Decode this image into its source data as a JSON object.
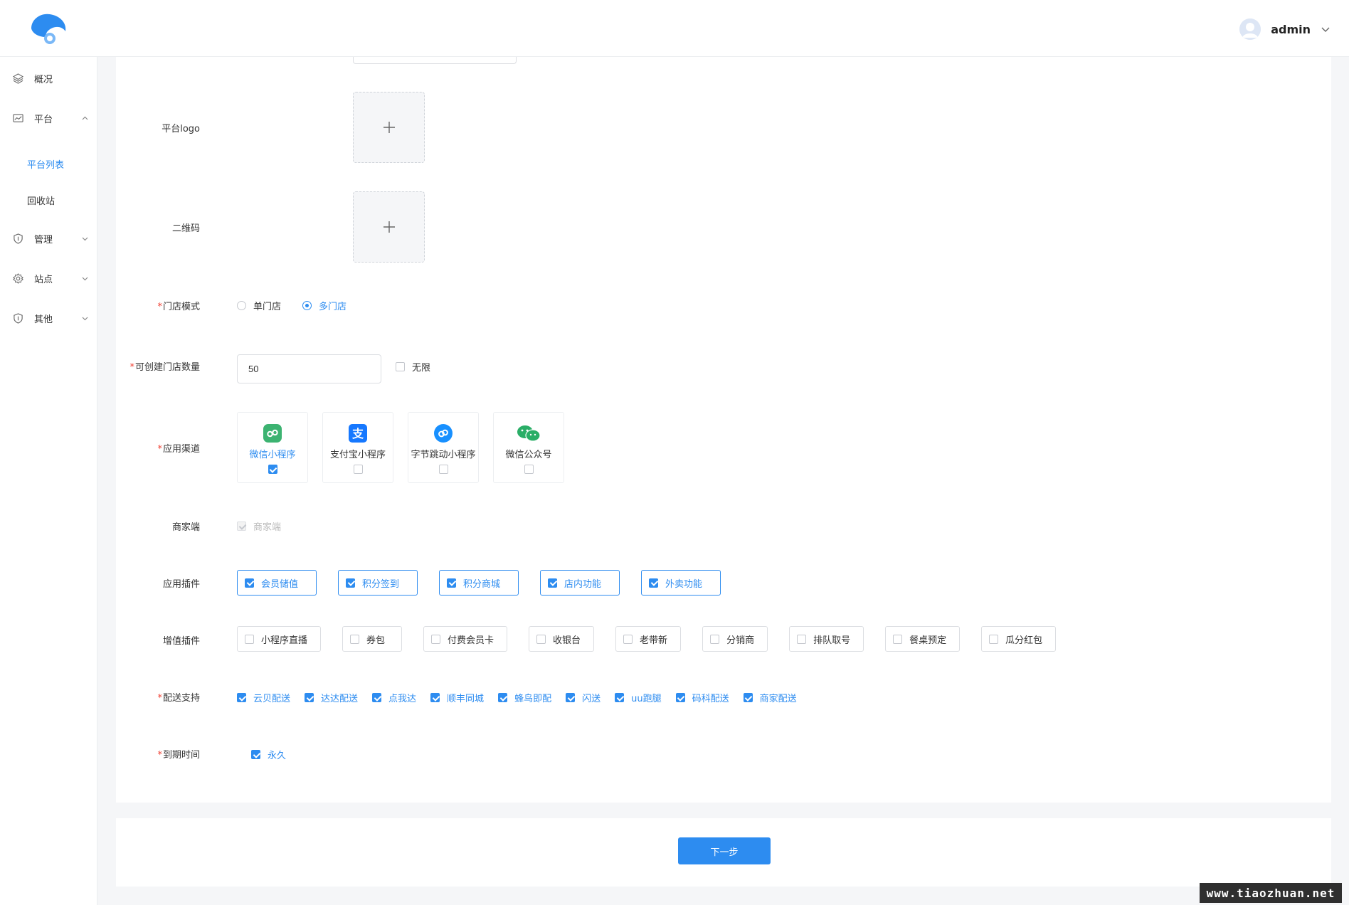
{
  "header": {
    "username": "admin"
  },
  "sidebar": {
    "items": [
      {
        "label": "概况",
        "icon": "layers-icon"
      },
      {
        "label": "平台",
        "icon": "chart-icon",
        "expanded": true
      },
      {
        "label": "管理",
        "icon": "shield-icon"
      },
      {
        "label": "站点",
        "icon": "gear-icon"
      },
      {
        "label": "其他",
        "icon": "shield-icon"
      }
    ],
    "sub_items": [
      {
        "label": "平台列表",
        "active": true
      },
      {
        "label": "回收站",
        "active": false
      }
    ]
  },
  "form": {
    "logo_label": "平台logo",
    "qrcode_label": "二维码",
    "store_mode": {
      "label": "门店模式",
      "options": [
        {
          "label": "单门店",
          "checked": false
        },
        {
          "label": "多门店",
          "checked": true
        }
      ]
    },
    "store_count": {
      "label": "可创建门店数量",
      "value": "50",
      "unlimited_label": "无限",
      "unlimited_checked": false
    },
    "channels": {
      "label": "应用渠道",
      "items": [
        {
          "label": "微信小程序",
          "checked": true,
          "color": "#3cb371"
        },
        {
          "label": "支付宝小程序",
          "checked": false,
          "color": "#1678ff"
        },
        {
          "label": "字节跳动小程序",
          "checked": false,
          "color": "#1890ff"
        },
        {
          "label": "微信公众号",
          "checked": false,
          "color": "#2aae67"
        }
      ]
    },
    "merchant": {
      "label": "商家端",
      "option": "商家端"
    },
    "plugins": {
      "label": "应用插件",
      "items": [
        "会员储值",
        "积分签到",
        "积分商城",
        "店内功能",
        "外卖功能"
      ]
    },
    "value_plugins": {
      "label": "增值插件",
      "items": [
        "小程序直播",
        "券包",
        "付费会员卡",
        "收银台",
        "老带新",
        "分销商",
        "排队取号",
        "餐桌预定",
        "瓜分红包"
      ]
    },
    "delivery": {
      "label": "配送支持",
      "items": [
        "云贝配送",
        "达达配送",
        "点我达",
        "顺丰同城",
        "蜂鸟即配",
        "闪送",
        "uu跑腿",
        "码科配送",
        "商家配送"
      ]
    },
    "expiry": {
      "label": "到期时间",
      "option": "永久"
    }
  },
  "footer": {
    "next_label": "下一步"
  },
  "watermark": "www.tiaozhuan.net",
  "colors": {
    "accent": "#2d8cf0",
    "required": "#f04134"
  }
}
